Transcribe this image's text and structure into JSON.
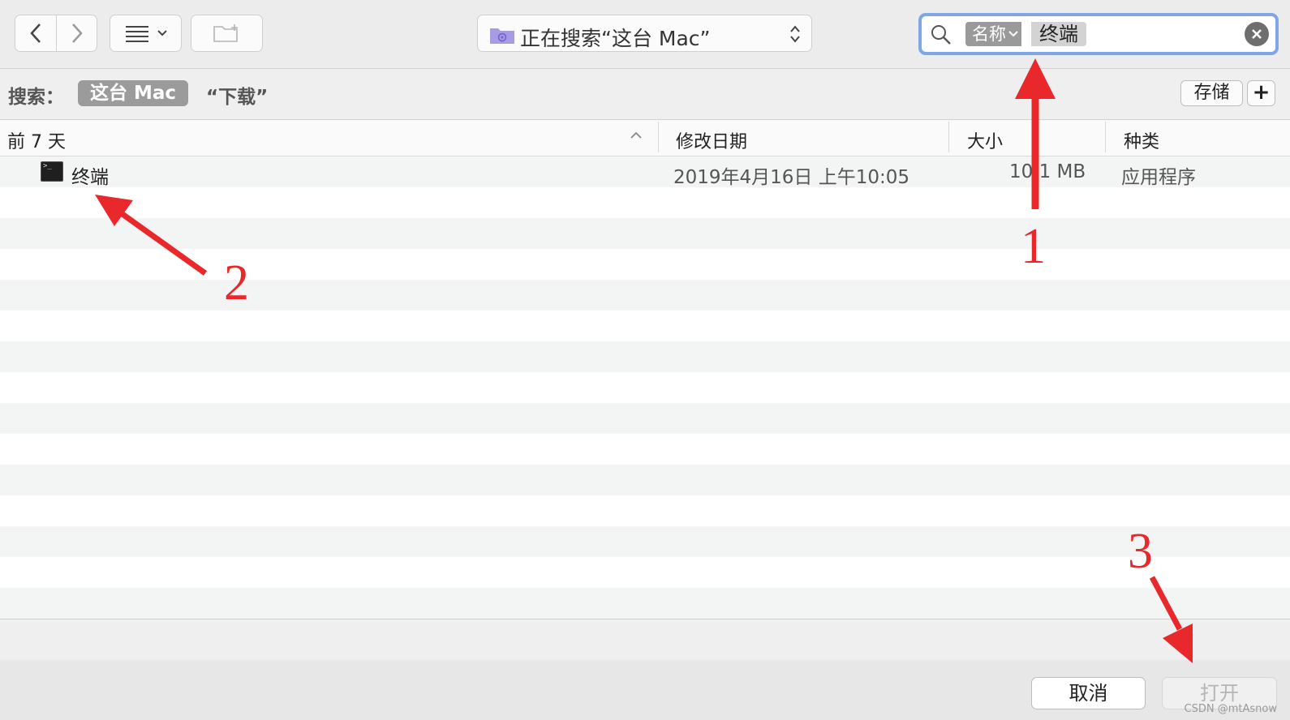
{
  "toolbar": {
    "location_text": "正在搜索“这台 Mac”",
    "search_token": "名称",
    "search_value": "终端"
  },
  "scope": {
    "label": "搜索：",
    "this_mac": "这台 Mac",
    "downloads": "“下载”",
    "save": "存储",
    "add": "+"
  },
  "table": {
    "headers": {
      "name": "前 7 天",
      "modified": "修改日期",
      "size": "大小",
      "kind": "种类"
    },
    "rows": [
      {
        "name": "终端",
        "modified": "2019年4月16日 上午10:05",
        "size": "10.1 MB",
        "kind": "应用程序"
      }
    ]
  },
  "buttons": {
    "cancel": "取消",
    "open": "打开"
  },
  "annotations": [
    "1",
    "2",
    "3"
  ],
  "watermark": "CSDN @mtAsnow",
  "colors": {
    "annotation_red": "#e8282b",
    "search_focus": "#7fa7e5",
    "scope_selected": "#9b9b9b"
  }
}
